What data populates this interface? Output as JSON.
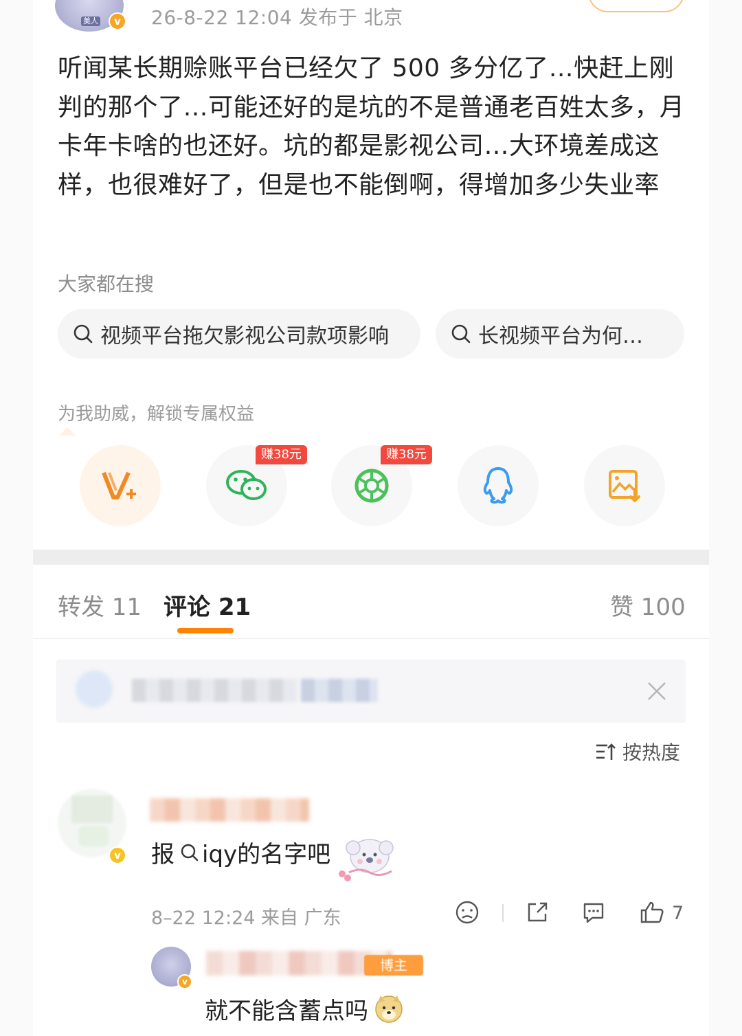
{
  "post": {
    "author_tag": "美人",
    "meta": "26-8-22 12:04  发布于 北京",
    "text": "听闻某长期赊账平台已经欠了 500 多分亿了…快赶上刚判的那个了…可能还好的是坑的不是普通老百姓太多，月卡年卡啥的也还好。坑的都是影视公司…大环境差成这样，也很难好了，但是也不能倒啊，得增加多少失业率",
    "search_title": "大家都在搜",
    "search_chips": [
      "视频平台拖欠影视公司款项影响",
      "长视频平台为何…"
    ],
    "unlock_text": "为我助威，解锁专属权益",
    "share": {
      "earn_label": "赚38元",
      "items": [
        "vplus-icon",
        "wechat-icon",
        "moments-icon",
        "qq-icon",
        "save-image-icon"
      ]
    }
  },
  "tabs": {
    "repost": "转发 11",
    "comment": "评论 21",
    "like": "赞 100"
  },
  "comments": {
    "sort_label": "按热度",
    "items": [
      {
        "text_prefix": "报",
        "text_suffix": "iqy的名字吧",
        "meta": "8–22 12:24 来自 广东",
        "likes": "7",
        "reply": {
          "tag": "博主",
          "text": "就不能含蓄点吗"
        }
      }
    ]
  },
  "colors": {
    "accent": "#ff8200",
    "earn_red": "#f2483e",
    "wechat_green": "#4cc15a",
    "qq_blue": "#3b9cf0"
  }
}
